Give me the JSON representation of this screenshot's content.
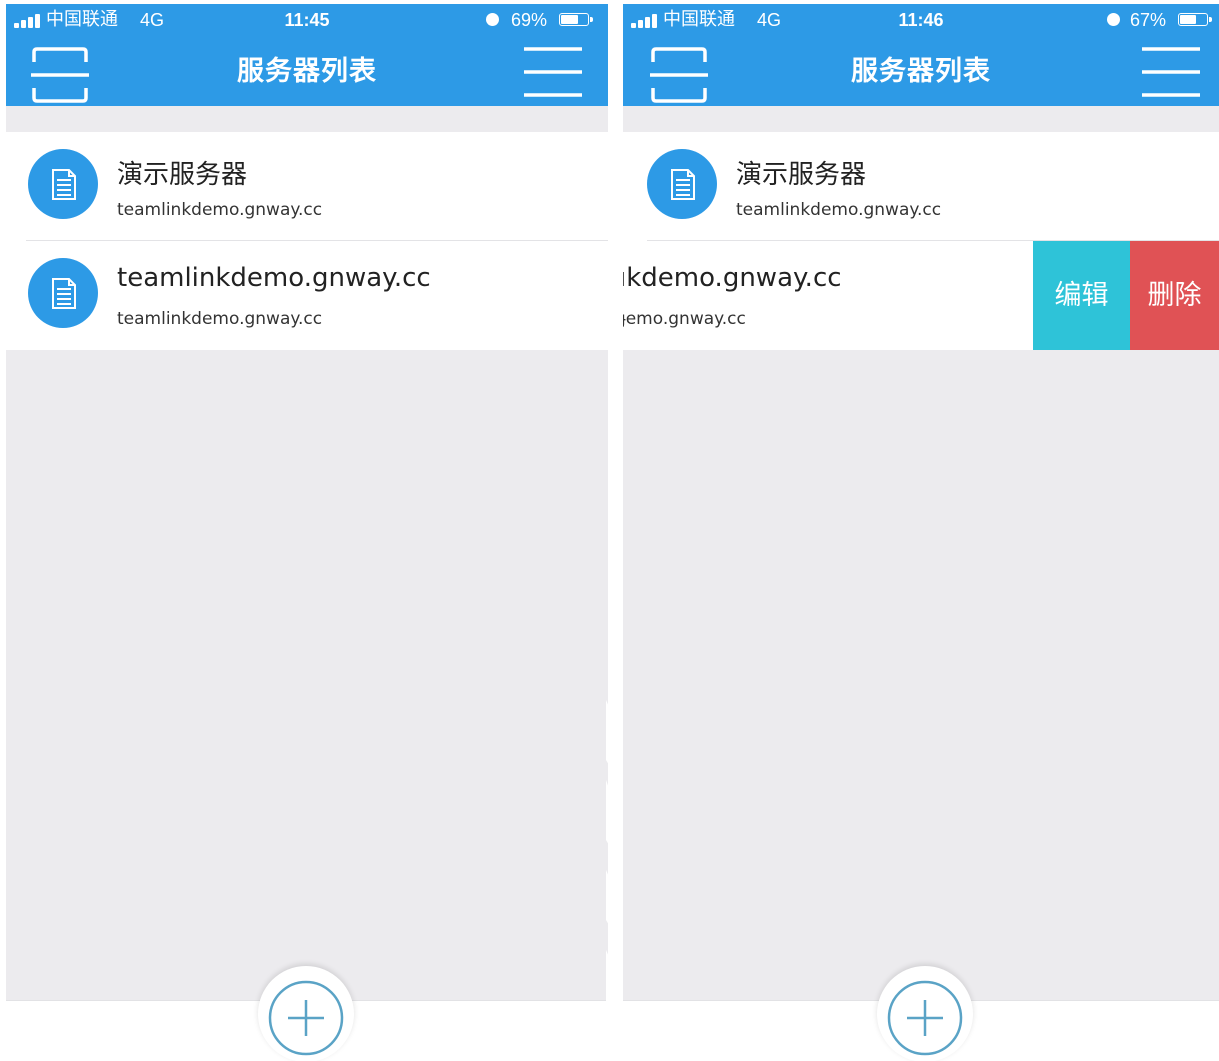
{
  "screens": [
    {
      "status": {
        "carrier": "中国联通",
        "network": "4G",
        "time": "11:45",
        "battery_text": "69%",
        "battery_level": 0.69
      },
      "nav": {
        "title": "服务器列表",
        "scan_icon": "scan-frame-icon",
        "menu_icon": "hamburger-menu-icon"
      },
      "servers": [
        {
          "name": "演示服务器",
          "address": "teamlinkdemo.gnway.cc",
          "icon": "document-icon"
        },
        {
          "name": "teamlinkdemo.gnway.cc",
          "address": "teamlinkdemo.gnway.cc",
          "icon": "document-icon"
        }
      ],
      "add_icon": "plus-circle-icon"
    },
    {
      "status": {
        "carrier": "中国联通",
        "network": "4G",
        "time": "11:46",
        "battery_text": "67%",
        "battery_level": 0.67
      },
      "nav": {
        "title": "服务器列表",
        "scan_icon": "scan-frame-icon",
        "menu_icon": "hamburger-menu-icon"
      },
      "servers": [
        {
          "name": "演示服务器",
          "address": "teamlinkdemo.gnway.cc",
          "icon": "document-icon"
        },
        {
          "name": "ıkdemo.gnway.cc",
          "address": "ɟemo.gnway.cc",
          "icon": "document-icon"
        }
      ],
      "swipe_actions": {
        "edit_label": "编辑",
        "delete_label": "删除"
      },
      "add_icon": "plus-circle-icon"
    }
  ],
  "colors": {
    "header": "#2d9ae6",
    "avatar": "#2d9ae6",
    "background": "#ecebee",
    "edit": "#2ec3d8",
    "delete": "#e05255",
    "fab_ring": "#5aa3c6"
  }
}
